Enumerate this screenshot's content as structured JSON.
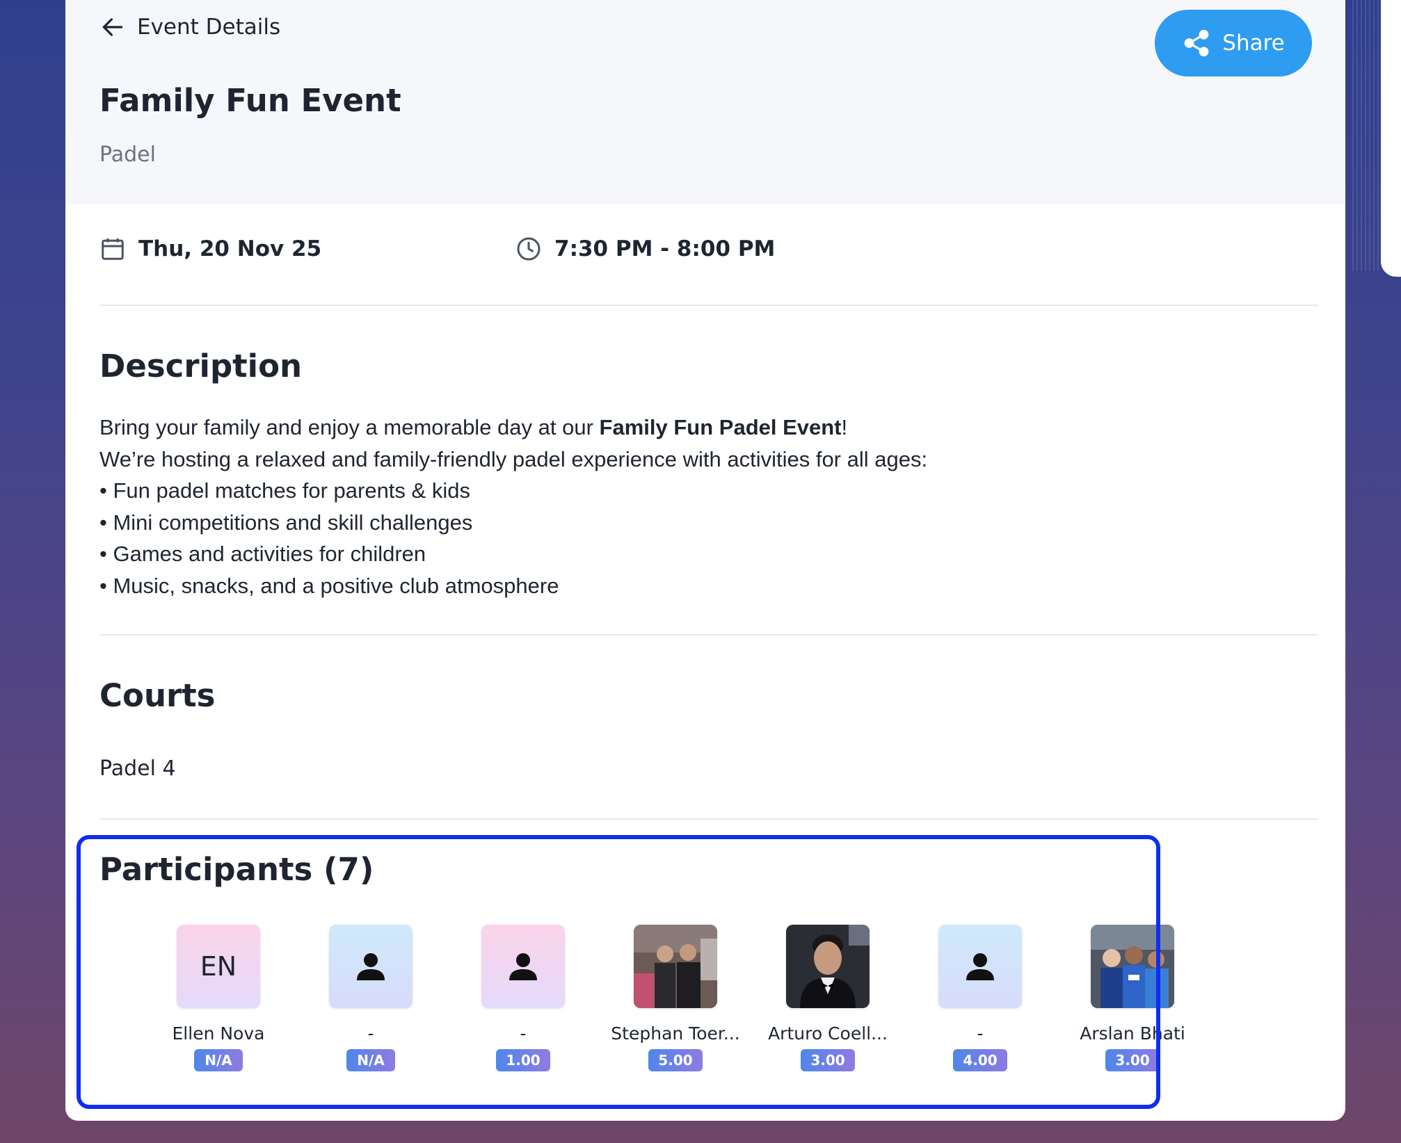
{
  "header": {
    "back_label": "Event Details",
    "share_label": "Share",
    "title": "Family Fun Event",
    "sport": "Padel"
  },
  "meta": {
    "date": "Thu, 20 Nov 25",
    "time": "7:30 PM - 8:00 PM"
  },
  "description": {
    "title": "Description",
    "line1_prefix": "Bring your family and enjoy a memorable day at our ",
    "line1_bold": "Family Fun Padel Event",
    "line1_suffix": "!",
    "line2": "We’re hosting a relaxed and family-friendly padel experience with activities for all ages:",
    "bullets": [
      "• Fun padel matches for parents & kids",
      "• Mini competitions and skill challenges",
      "• Games and activities for children",
      "• Music, snacks, and a positive club atmosphere"
    ]
  },
  "courts": {
    "title": "Courts",
    "items": [
      "Padel 4"
    ]
  },
  "participants": {
    "title": "Participants (7)",
    "items": [
      {
        "name": "Ellen Nova",
        "level": "N/A",
        "initials": "EN",
        "avatar": "initials-pink"
      },
      {
        "name": "-",
        "level": "N/A",
        "avatar": "person-icon-blue"
      },
      {
        "name": "-",
        "level": "1.00",
        "avatar": "person-icon-pink"
      },
      {
        "name": "Stephan Toer...",
        "level": "5.00",
        "avatar": "photo"
      },
      {
        "name": "Arturo Coell...",
        "level": "3.00",
        "avatar": "photo"
      },
      {
        "name": "-",
        "level": "4.00",
        "avatar": "person-icon-blue"
      },
      {
        "name": "Arslan Bhati",
        "level": "3.00",
        "avatar": "photo"
      }
    ]
  },
  "colors": {
    "share_button": "#2d9cf1",
    "highlight_border": "#0f2ef0",
    "badge_start": "#4f87e8",
    "badge_end": "#8e7be2"
  }
}
